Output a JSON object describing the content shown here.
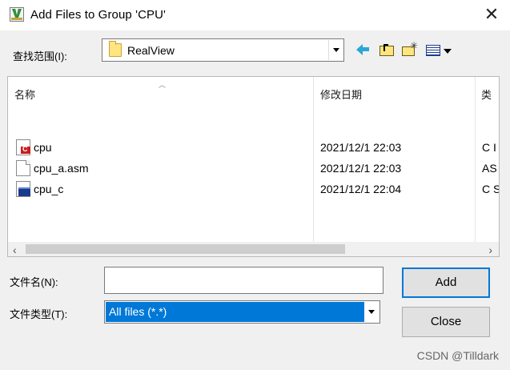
{
  "window": {
    "title": "Add Files to Group 'CPU'"
  },
  "look_in": {
    "label": "查找范围(I):",
    "value": "RealView"
  },
  "toolbar": {
    "back": "back-arrow-icon",
    "up": "up-folder-icon",
    "new_folder": "new-folder-icon",
    "view": "view-menu-icon"
  },
  "file_list": {
    "columns": [
      "名称",
      "修改日期",
      "类"
    ],
    "rows": [
      {
        "name": "cpu",
        "modified": "2021/12/1 22:03",
        "type": "C I",
        "icon": "c-source-icon"
      },
      {
        "name": "cpu_a.asm",
        "modified": "2021/12/1 22:03",
        "type": "AS",
        "icon": "asm-file-icon"
      },
      {
        "name": "cpu_c",
        "modified": "2021/12/1 22:04",
        "type": "C S",
        "icon": "object-file-icon"
      }
    ]
  },
  "file_name": {
    "label": "文件名(N):",
    "value": ""
  },
  "file_type": {
    "label": "文件类型(T):",
    "value": "All files (*.*)"
  },
  "buttons": {
    "add": "Add",
    "close": "Close"
  },
  "watermark": "CSDN @Tilldark",
  "colors": {
    "selection": "#0078d7",
    "default_button_border": "#0078d7",
    "dialog_bg": "#f0f0f0"
  }
}
